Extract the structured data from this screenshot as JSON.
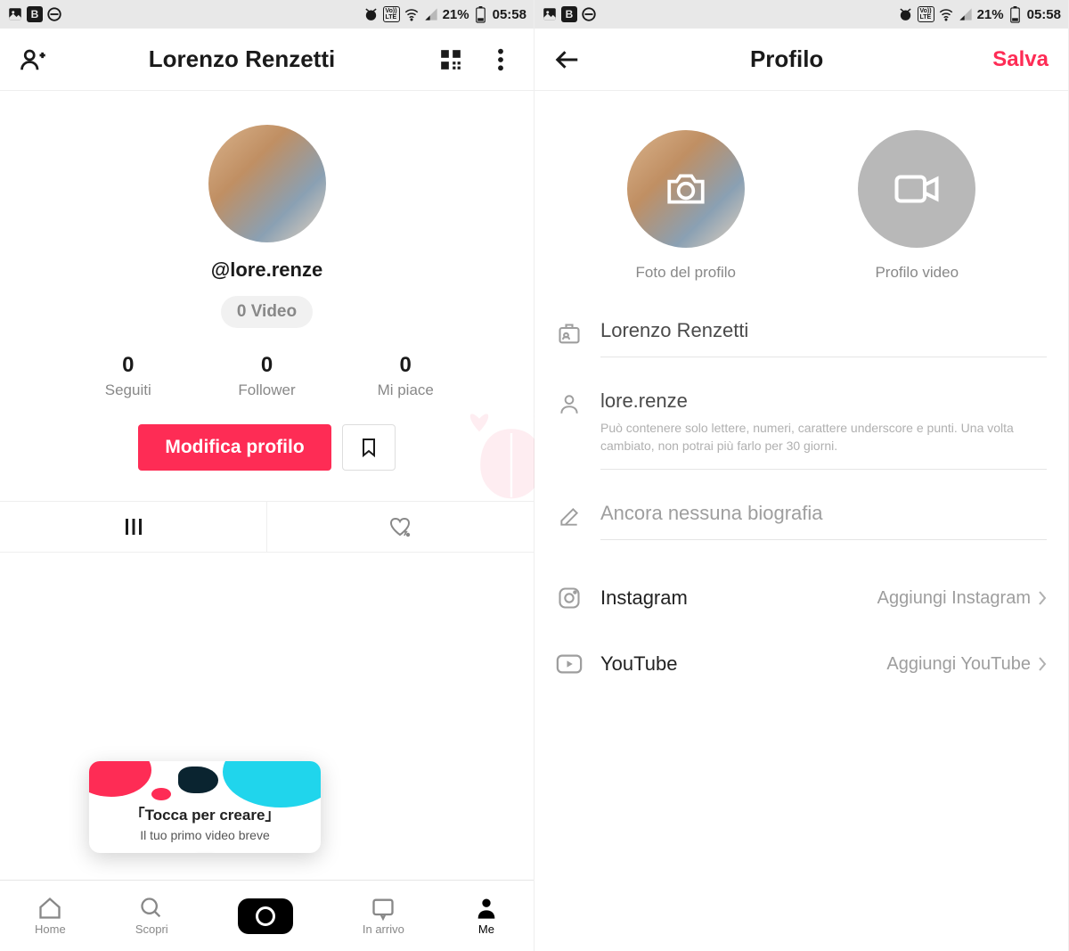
{
  "status": {
    "lte": "LTE",
    "volte": "Vo))",
    "battery": "21%",
    "time": "05:58",
    "bold_b": "B"
  },
  "left": {
    "header_title": "Lorenzo Renzetti",
    "username": "@lore.renze",
    "video_pill": "0 Video",
    "stats": {
      "following_num": "0",
      "following_label": "Seguiti",
      "followers_num": "0",
      "followers_label": "Follower",
      "likes_num": "0",
      "likes_label": "Mi piace"
    },
    "edit_btn": "Modifica profilo",
    "create_card_title": "「Tocca per creare」",
    "create_card_sub": "Il tuo primo video breve",
    "nav": {
      "home": "Home",
      "discover": "Scopri",
      "inbox": "In arrivo",
      "me": "Me"
    }
  },
  "right": {
    "header_title": "Profilo",
    "save_label": "Salva",
    "photo_label": "Foto del profilo",
    "video_label": "Profilo video",
    "name_value": "Lorenzo Renzetti",
    "username_value": "lore.renze",
    "username_help": "Può contenere solo lettere, numeri, carattere underscore e punti. Una volta cambiato, non potrai più farlo per 30 giorni.",
    "bio_placeholder": "Ancora nessuna biografia",
    "instagram_label": "Instagram",
    "instagram_action": "Aggiungi Instagram",
    "youtube_label": "YouTube",
    "youtube_action": "Aggiungi YouTube"
  }
}
